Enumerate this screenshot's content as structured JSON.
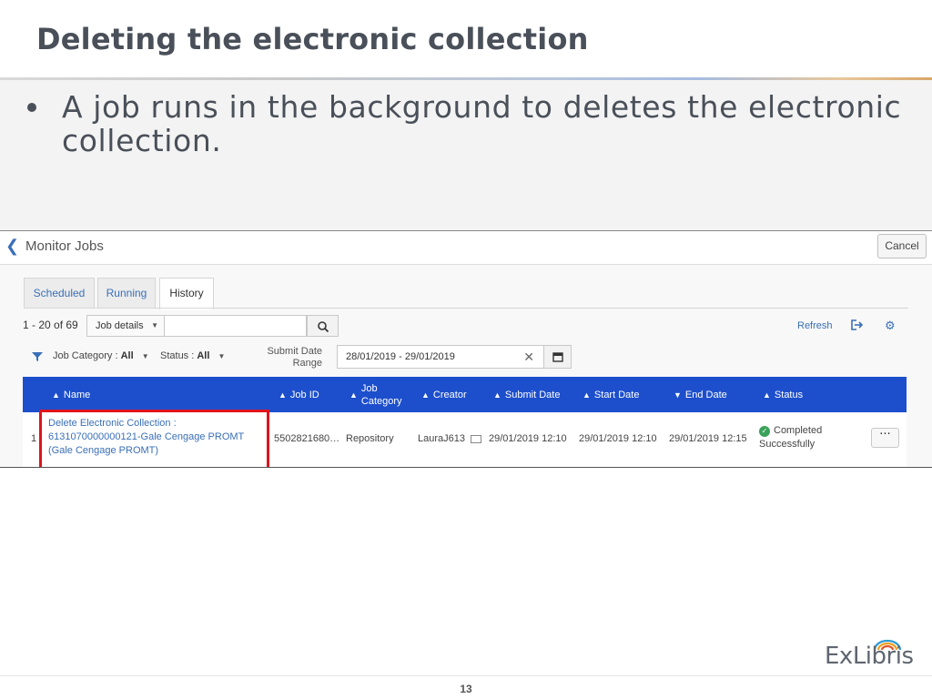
{
  "slide": {
    "title": "Deleting the electronic collection",
    "bullet": "A job runs in the background to deletes the electronic collection.",
    "page_number": "13",
    "logo_text": "ExLibris"
  },
  "app": {
    "page_title": "Monitor Jobs",
    "cancel_label": "Cancel",
    "tabs": [
      {
        "label": "Scheduled",
        "active": false
      },
      {
        "label": "Running",
        "active": false
      },
      {
        "label": "History",
        "active": true
      }
    ],
    "result_count": "1 - 20 of 69",
    "search_scope": "Job details",
    "search_placeholder": "",
    "refresh_label": "Refresh",
    "filters": {
      "job_category_label": "Job Category :",
      "job_category_value": "All",
      "status_label": "Status :",
      "status_value": "All",
      "submit_date_label": "Submit Date Range",
      "submit_date_range": "28/01/2019 - 29/01/2019"
    },
    "table": {
      "columns": [
        "Name",
        "Job ID",
        "Job Category",
        "Creator",
        "Submit Date",
        "Start Date",
        "End Date",
        "Status"
      ],
      "rows": [
        {
          "row_index": "1",
          "name": "Delete Electronic Collection : 6131070000000121-Gale Cengage PROMT (Gale Cengage PROMT)",
          "job_id": "5502821680…",
          "job_category": "Repository",
          "creator": "LauraJ613",
          "submit_date": "29/01/2019 12:10",
          "start_date": "29/01/2019 12:10",
          "end_date": "29/01/2019 12:15",
          "status": "Completed Successfully"
        }
      ]
    }
  },
  "colors": {
    "header_blue": "#1d4fcc",
    "link_blue": "#3a6fb7",
    "highlight_red": "#e0141c",
    "success_green": "#3aa25a"
  }
}
